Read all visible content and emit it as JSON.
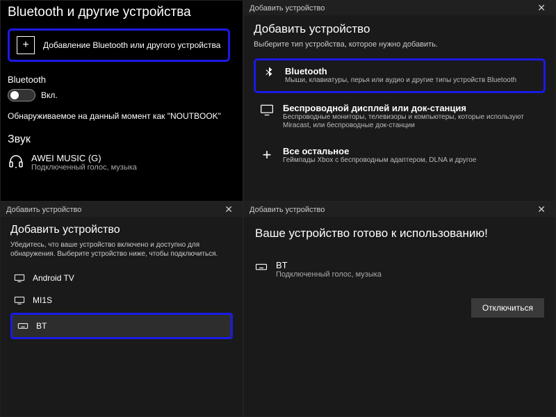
{
  "settings": {
    "title": "Bluetooth и другие устройства",
    "add_button": "Добавление Bluetooth или другого устройства",
    "bt_label": "Bluetooth",
    "toggle_state": "Вкл.",
    "discoverable": "Обнаруживаемое на данный момент как \"NOUTBOOK\"",
    "sound_header": "Звук",
    "audio_device": {
      "name": "AWEI MUSIC (G)",
      "sub": "Подключенный голос, музыка"
    }
  },
  "add_dialog": {
    "window_title": "Добавить устройство",
    "heading": "Добавить устройство",
    "subheading": "Выберите тип устройства, которое нужно добавить.",
    "options": [
      {
        "title": "Bluetooth",
        "desc": "Мыши, клавиатуры, перья или аудио и другие типы устройств Bluetooth",
        "icon": "bluetooth"
      },
      {
        "title": "Беспроводной дисплей или док-станция",
        "desc": "Беспроводные мониторы, телевизоры и компьютеры, которые используют Miracast, или беспроводные док-станции",
        "icon": "display"
      },
      {
        "title": "Все остальное",
        "desc": "Геймпады Xbox с беспроводным адаптером, DLNA и другое",
        "icon": "plus"
      }
    ]
  },
  "picker": {
    "window_title": "Добавить устройство",
    "heading": "Добавить устройство",
    "sub": "Убедитесь, что ваше устройство включено и доступно для обнаружения. Выберите устройство ниже, чтобы подключиться.",
    "devices": [
      {
        "name": "Android TV",
        "icon": "display"
      },
      {
        "name": "MI1S",
        "icon": "display"
      },
      {
        "name": "BT",
        "icon": "keyboard",
        "highlight": true
      }
    ]
  },
  "ready": {
    "window_title": "Добавить устройство",
    "heading": "Ваше устройство готово к использованию!",
    "device": {
      "name": "BT",
      "sub": "Подключенный голос, музыка"
    },
    "disconnect": "Отключиться"
  }
}
